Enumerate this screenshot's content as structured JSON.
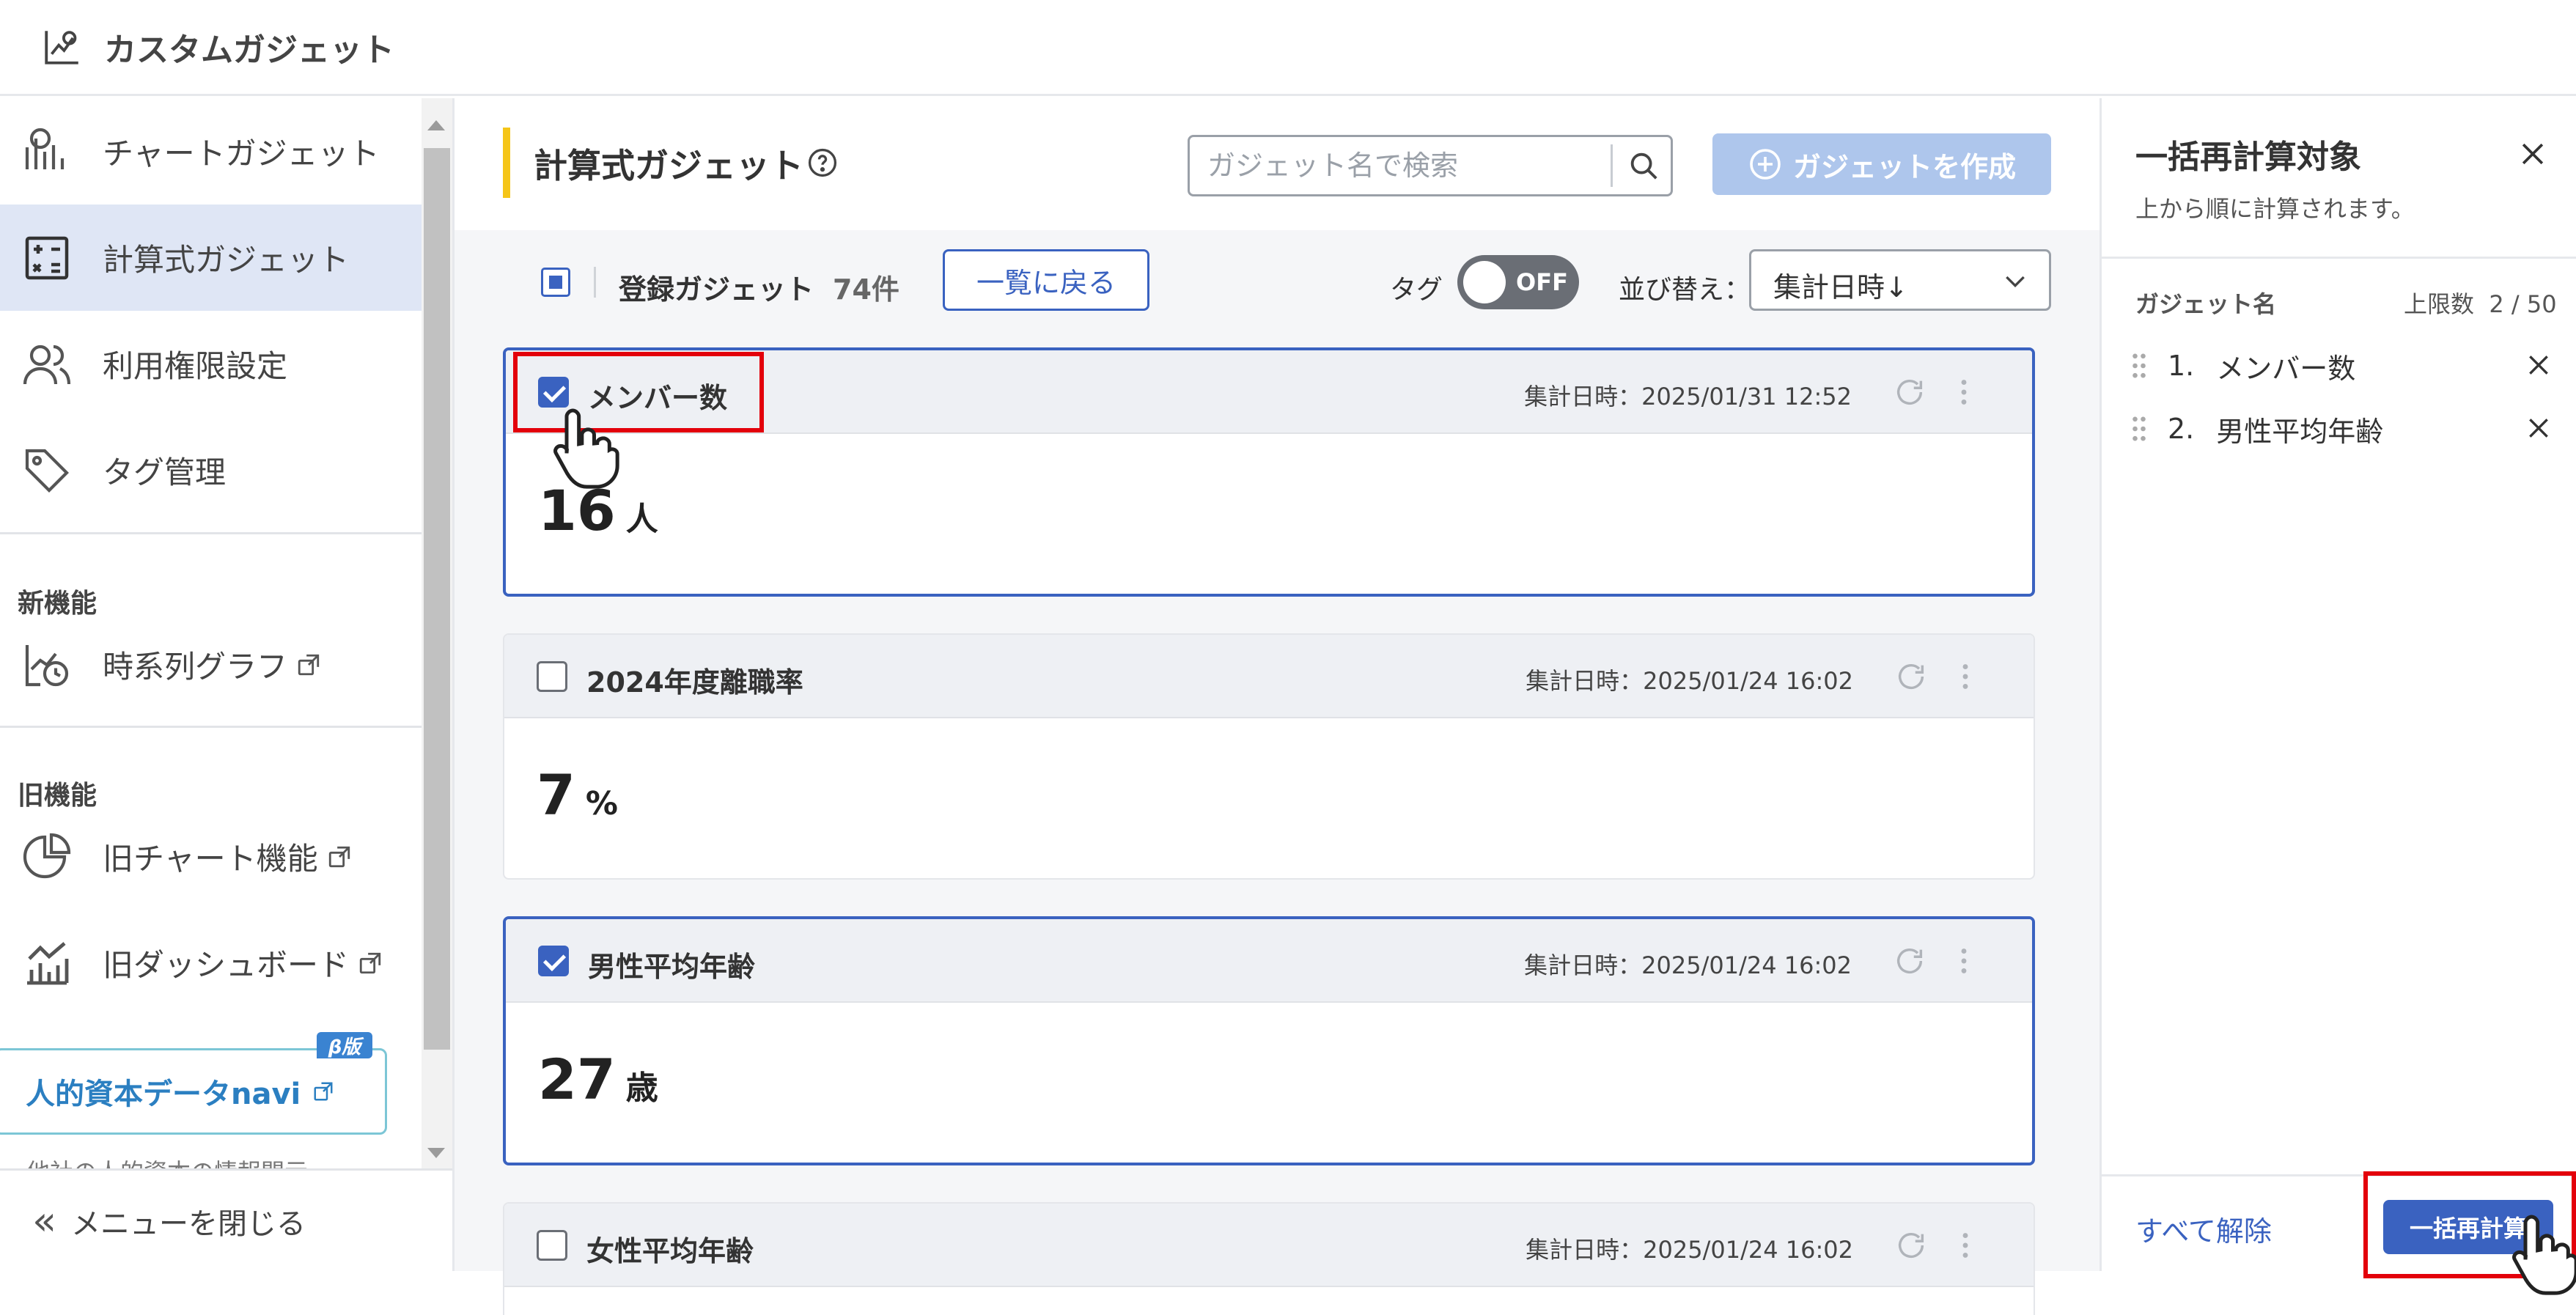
{
  "app": {
    "title": "カスタムガジェット"
  },
  "sidebar": {
    "items": [
      {
        "label": "チャートガジェット",
        "icon": "chart-gadget-icon",
        "active": false
      },
      {
        "label": "計算式ガジェット",
        "icon": "formula-gadget-icon",
        "active": true
      },
      {
        "label": "利用権限設定",
        "icon": "users-icon",
        "active": false
      },
      {
        "label": "タグ管理",
        "icon": "tag-icon",
        "active": false
      }
    ],
    "new_section_label": "新機能",
    "new_items": [
      {
        "label": "時系列グラフ",
        "icon": "timeseries-icon",
        "external": true
      }
    ],
    "old_section_label": "旧機能",
    "old_items": [
      {
        "label": "旧チャート機能",
        "icon": "pie-chart-icon",
        "external": true
      },
      {
        "label": "旧ダッシュボード",
        "icon": "dashboard-icon",
        "external": true
      }
    ],
    "navi_banner": {
      "text": "人的資本データnavi",
      "badge": "β版"
    },
    "cut_text": "他社の人的資本の情報開示",
    "footer_label": "メニューを閉じる"
  },
  "main": {
    "title": "計算式ガジェット",
    "search": {
      "placeholder": "ガジェット名で検索",
      "value": ""
    },
    "create_label": "ガジェットを作成",
    "toolbar": {
      "registered_label": "登録ガジェット",
      "registered_count": "74件",
      "back_label": "一覧に戻る",
      "tag_label": "タグ",
      "toggle_state": "OFF",
      "sort_label": "並び替え：",
      "sort_value": "集計日時↓"
    },
    "cards": [
      {
        "name": "メンバー数",
        "meta": "集計日時：2025/01/31 12:52",
        "value": "16",
        "unit": "人",
        "checked": true
      },
      {
        "name": "2024年度離職率",
        "meta": "集計日時：2025/01/24 16:02",
        "value": "7",
        "unit": "%",
        "checked": false
      },
      {
        "name": "男性平均年齢",
        "meta": "集計日時：2025/01/24 16:02",
        "value": "27",
        "unit": "歳",
        "checked": true
      },
      {
        "name": "女性平均年齢",
        "meta": "集計日時：2025/01/24 16:02",
        "value": "",
        "unit": "",
        "checked": false
      }
    ]
  },
  "panel": {
    "title": "一括再計算対象",
    "subtitle": "上から順に計算されます。",
    "col_name": "ガジェット名",
    "col_limit": "上限数",
    "limit_value": "2 / 50",
    "queue": [
      {
        "index": "1.",
        "name": "メンバー数"
      },
      {
        "index": "2.",
        "name": "男性平均年齢"
      }
    ],
    "clear_label": "すべて解除",
    "recalc_label": "一括再計算"
  },
  "colors": {
    "accent": "#3a62c0",
    "highlight": "#e3000b",
    "title_bar": "#f5c518",
    "active_bg": "#dfe6f5"
  }
}
